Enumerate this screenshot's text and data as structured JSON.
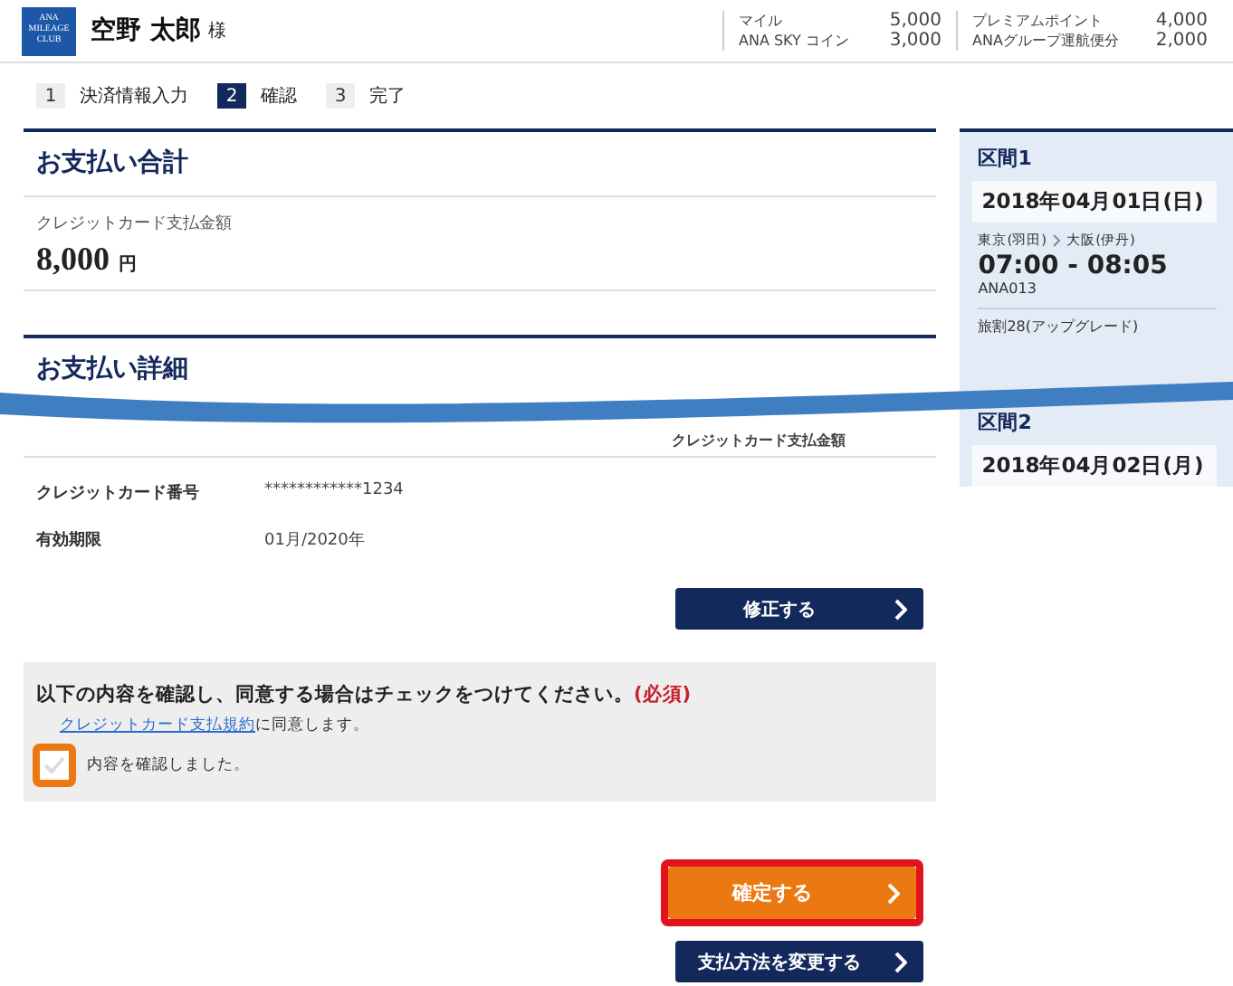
{
  "header": {
    "logo": [
      "ANA",
      "MILEAGE",
      "CLUB"
    ],
    "user_name": "空野 太郎",
    "honorific": "様",
    "balances": [
      {
        "label": "マイル",
        "value": "5,000"
      },
      {
        "label": "ANA SKY コイン",
        "value": "3,000"
      },
      {
        "label": "プレミアムポイント",
        "value": "4,000"
      },
      {
        "label": "ANAグループ運航便分",
        "value": "2,000"
      }
    ]
  },
  "steps": [
    {
      "number": "1",
      "label": "決済情報入力",
      "selected": false
    },
    {
      "number": "2",
      "label": "確認",
      "selected": true
    },
    {
      "number": "3",
      "label": "完了",
      "selected": false
    }
  ],
  "payment_total": {
    "title": "お支払い合計",
    "label": "クレジットカード支払金額",
    "amount": "8,000",
    "unit": "円"
  },
  "payment_details": {
    "title": "お支払い詳細",
    "column_header": "クレジットカード支払金額",
    "rows": [
      {
        "label": "クレジットカード番号",
        "value": "************1234"
      },
      {
        "label": "有効期限",
        "value": "01月/2020年"
      }
    ],
    "edit_button": "修正する"
  },
  "agreement": {
    "title": "以下の内容を確認し、同意する場合はチェックをつけてください。",
    "required": "(必須)",
    "terms_link": "クレジットカード支払規約",
    "terms_suffix": "に同意します。",
    "checkbox": {
      "label": "内容を確認しました。",
      "checked": false
    }
  },
  "buttons": [
    {
      "label": "確定する",
      "kind": "primary",
      "highlighted": true
    },
    {
      "label": "支払方法を変更する",
      "kind": "secondary",
      "highlighted": false
    }
  ],
  "sidebar": {
    "segments": [
      {
        "title": "区間1",
        "date": "2018年04月01日(日)",
        "from": "東京(羽田)",
        "to": "大阪(伊丹)",
        "time": "07:00 - 08:05",
        "flight": "ANA013",
        "fare": "旅割28(アップグレード)"
      },
      {
        "title": "区間2",
        "date": "2018年04月02日(月)"
      }
    ]
  }
}
